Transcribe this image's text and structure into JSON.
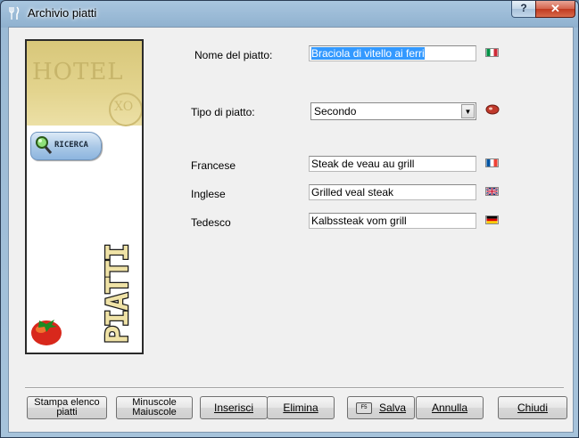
{
  "window": {
    "title": "Archivio piatti",
    "help_label": "?",
    "close_label": "✕"
  },
  "side_panel": {
    "hotel_word": "HOTEL",
    "hotel_seal": "XO",
    "search_button": "RICERCA",
    "vertical_title": "PIATTI"
  },
  "form": {
    "dish_name_label": "Nome del piatto:",
    "dish_name_value": "Braciola di vitello ai ferri",
    "dish_type_label": "Tipo di piatto:",
    "dish_type_value": "Secondo",
    "french_label": "Francese",
    "french_value": "Steak de veau au grill",
    "english_label": "Inglese",
    "english_value": "Grilled veal steak",
    "german_label": "Tedesco",
    "german_value": "Kalbssteak vom grill"
  },
  "buttons": {
    "print_line1": "Stampa elenco",
    "print_line2": "piatti",
    "case_line1": "Minuscole",
    "case_line2": "Maiuscole",
    "insert": "Inserisci",
    "delete": "Elimina",
    "save": "Salva",
    "save_key": "F5",
    "cancel": "Annulla",
    "close": "Chiudi"
  },
  "colors": {
    "selection": "#3399ff",
    "close_red": "#c03a20"
  }
}
